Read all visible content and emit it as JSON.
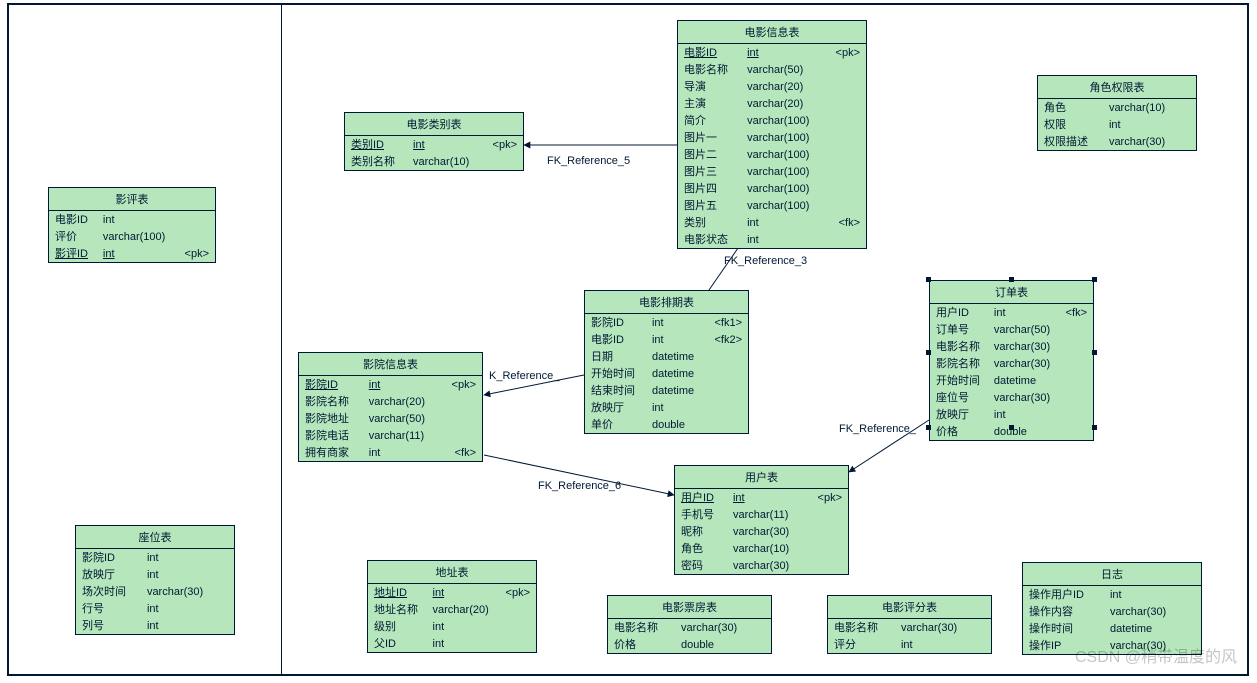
{
  "watermark": "CSDN @稍带温度的风",
  "entities": {
    "movie_info": {
      "title": "电影信息表",
      "rows": [
        {
          "name": "电影ID",
          "type": "int",
          "key": "<pk>",
          "pk": true
        },
        {
          "name": "电影名称",
          "type": "varchar(50)",
          "key": ""
        },
        {
          "name": "导演",
          "type": "varchar(20)",
          "key": ""
        },
        {
          "name": "主演",
          "type": "varchar(20)",
          "key": ""
        },
        {
          "name": "简介",
          "type": "varchar(100)",
          "key": ""
        },
        {
          "name": "图片一",
          "type": "varchar(100)",
          "key": ""
        },
        {
          "name": "图片二",
          "type": "varchar(100)",
          "key": ""
        },
        {
          "name": "图片三",
          "type": "varchar(100)",
          "key": ""
        },
        {
          "name": "图片四",
          "type": "varchar(100)",
          "key": ""
        },
        {
          "name": "图片五",
          "type": "varchar(100)",
          "key": ""
        },
        {
          "name": "类别",
          "type": "int",
          "key": "<fk>"
        },
        {
          "name": "电影状态",
          "type": "int",
          "key": ""
        }
      ]
    },
    "role_perm": {
      "title": "角色权限表",
      "rows": [
        {
          "name": "角色",
          "type": "varchar(10)",
          "key": ""
        },
        {
          "name": "权限",
          "type": "int",
          "key": ""
        },
        {
          "name": "权限描述",
          "type": "varchar(30)",
          "key": ""
        }
      ]
    },
    "movie_cat": {
      "title": "电影类别表",
      "rows": [
        {
          "name": "类别ID",
          "type": "int",
          "key": "<pk>",
          "pk": true
        },
        {
          "name": "类别名称",
          "type": "varchar(10)",
          "key": ""
        }
      ]
    },
    "review": {
      "title": "影评表",
      "rows": [
        {
          "name": "电影ID",
          "type": "int",
          "key": ""
        },
        {
          "name": "评价",
          "type": "varchar(100)",
          "key": ""
        },
        {
          "name": "影评ID",
          "type": "int",
          "key": "<pk>",
          "pk": true
        }
      ]
    },
    "schedule": {
      "title": "电影排期表",
      "rows": [
        {
          "name": "影院ID",
          "type": "int",
          "key": "<fk1>"
        },
        {
          "name": "电影ID",
          "type": "int",
          "key": "<fk2>"
        },
        {
          "name": "日期",
          "type": "datetime",
          "key": ""
        },
        {
          "name": "开始时间",
          "type": "datetime",
          "key": ""
        },
        {
          "name": "结束时间",
          "type": "datetime",
          "key": ""
        },
        {
          "name": "放映厅",
          "type": "int",
          "key": ""
        },
        {
          "name": "单价",
          "type": "double",
          "key": ""
        }
      ]
    },
    "order": {
      "title": "订单表",
      "rows": [
        {
          "name": "用户ID",
          "type": "int",
          "key": "<fk>"
        },
        {
          "name": "订单号",
          "type": "varchar(50)",
          "key": ""
        },
        {
          "name": "电影名称",
          "type": "varchar(30)",
          "key": ""
        },
        {
          "name": "影院名称",
          "type": "varchar(30)",
          "key": ""
        },
        {
          "name": "开始时间",
          "type": "datetime",
          "key": ""
        },
        {
          "name": "座位号",
          "type": "varchar(30)",
          "key": ""
        },
        {
          "name": "放映厅",
          "type": "int",
          "key": ""
        },
        {
          "name": "价格",
          "type": "double",
          "key": ""
        }
      ]
    },
    "cinema": {
      "title": "影院信息表",
      "rows": [
        {
          "name": "影院ID",
          "type": "int",
          "key": "<pk>",
          "pk": true
        },
        {
          "name": "影院名称",
          "type": "varchar(20)",
          "key": ""
        },
        {
          "name": "影院地址",
          "type": "varchar(50)",
          "key": ""
        },
        {
          "name": "影院电话",
          "type": "varchar(11)",
          "key": ""
        },
        {
          "name": "拥有商家",
          "type": "int",
          "key": "<fk>"
        }
      ]
    },
    "user": {
      "title": "用户表",
      "rows": [
        {
          "name": "用户ID",
          "type": "int",
          "key": "<pk>",
          "pk": true
        },
        {
          "name": "手机号",
          "type": "varchar(11)",
          "key": ""
        },
        {
          "name": "昵称",
          "type": "varchar(30)",
          "key": ""
        },
        {
          "name": "角色",
          "type": "varchar(10)",
          "key": ""
        },
        {
          "name": "密码",
          "type": "varchar(30)",
          "key": ""
        }
      ]
    },
    "seat": {
      "title": "座位表",
      "rows": [
        {
          "name": "影院ID",
          "type": "int",
          "key": ""
        },
        {
          "name": "放映厅",
          "type": "int",
          "key": ""
        },
        {
          "name": "场次时间",
          "type": "varchar(30)",
          "key": ""
        },
        {
          "name": "行号",
          "type": "int",
          "key": ""
        },
        {
          "name": "列号",
          "type": "int",
          "key": ""
        }
      ]
    },
    "address": {
      "title": "地址表",
      "rows": [
        {
          "name": "地址ID",
          "type": "int",
          "key": "<pk>",
          "pk": true
        },
        {
          "name": "地址名称",
          "type": "varchar(20)",
          "key": ""
        },
        {
          "name": "级别",
          "type": "int",
          "key": ""
        },
        {
          "name": "父ID",
          "type": "int",
          "key": ""
        }
      ]
    },
    "boxoffice": {
      "title": "电影票房表",
      "rows": [
        {
          "name": "电影名称",
          "type": "varchar(30)",
          "key": ""
        },
        {
          "name": "价格",
          "type": "double",
          "key": ""
        }
      ]
    },
    "rating": {
      "title": "电影评分表",
      "rows": [
        {
          "name": "电影名称",
          "type": "varchar(30)",
          "key": ""
        },
        {
          "name": "评分",
          "type": "int",
          "key": ""
        }
      ]
    },
    "log": {
      "title": "日志",
      "rows": [
        {
          "name": "操作用户ID",
          "type": "int",
          "key": ""
        },
        {
          "name": "操作内容",
          "type": "varchar(30)",
          "key": ""
        },
        {
          "name": "操作时间",
          "type": "datetime",
          "key": ""
        },
        {
          "name": "操作IP",
          "type": "varchar(30)",
          "key": ""
        }
      ]
    }
  },
  "refs": {
    "r5": "FK_Reference_5",
    "r3": "FK_Reference_3",
    "rK": "K_Reference_",
    "r6": "FK_Reference_6",
    "r?": "FK_Reference_"
  }
}
